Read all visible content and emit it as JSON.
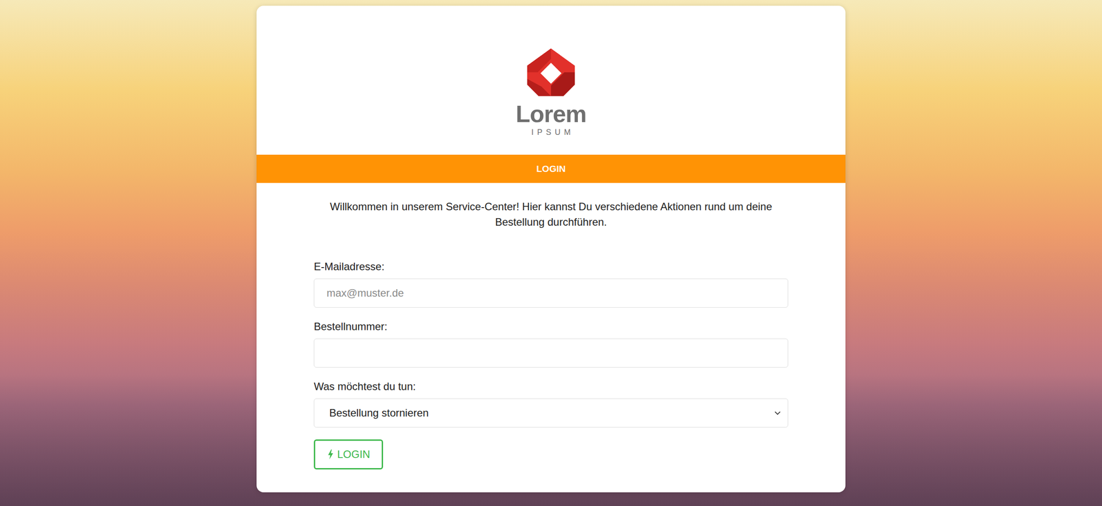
{
  "logo": {
    "name": "Lorem",
    "tagline": "IPSUM"
  },
  "header": {
    "title": "LOGIN"
  },
  "intro": "Willkommen in unserem Service-Center! Hier kannst Du verschiedene Aktionen rund um deine Bestellung durchführen.",
  "form": {
    "email": {
      "label": "E-Mailadresse:",
      "placeholder": "max@muster.de",
      "value": ""
    },
    "order_number": {
      "label": "Bestellnummer:",
      "value": ""
    },
    "action": {
      "label": "Was möchtest du tun:",
      "value": "Bestellung stornieren"
    }
  },
  "buttons": [
    "LOGIN"
  ]
}
